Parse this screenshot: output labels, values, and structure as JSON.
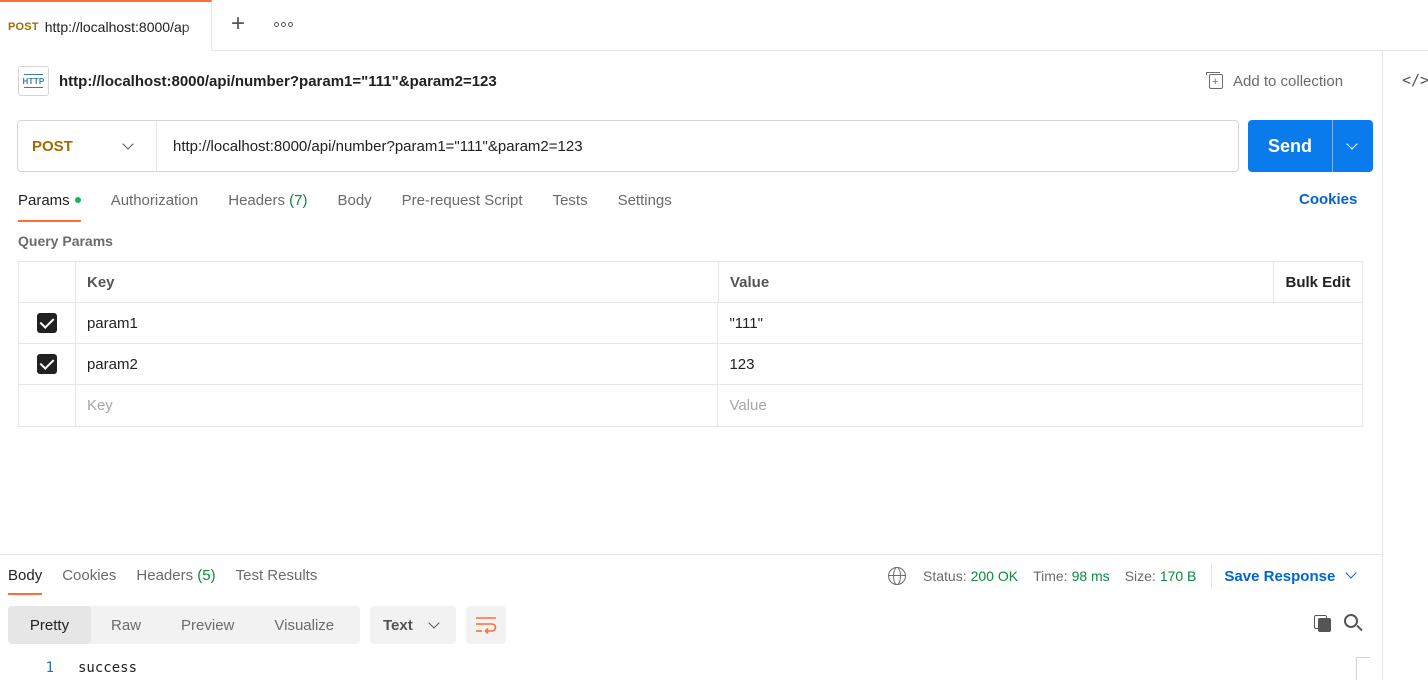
{
  "tab": {
    "method": "POST",
    "title": "http://localhost:8000/ap"
  },
  "tabbar": {
    "new_tab_icon": "plus-icon",
    "more_icon": "ellipsis-icon"
  },
  "request": {
    "title": "http://localhost:8000/api/number?param1=\"111\"&param2=123",
    "add_to_collection": "Add to collection",
    "method": "POST",
    "url": "http://localhost:8000/api/number?param1=\"111\"&param2=123",
    "send_label": "Send"
  },
  "request_tabs": [
    {
      "label": "Params",
      "count": ""
    },
    {
      "label": "Authorization",
      "count": ""
    },
    {
      "label": "Headers",
      "count": "(7)"
    },
    {
      "label": "Body",
      "count": ""
    },
    {
      "label": "Pre-request Script",
      "count": ""
    },
    {
      "label": "Tests",
      "count": ""
    },
    {
      "label": "Settings",
      "count": ""
    }
  ],
  "cookies_link": "Cookies",
  "query_params": {
    "title": "Query Params",
    "headers": {
      "key": "Key",
      "value": "Value",
      "bulk_edit": "Bulk Edit"
    },
    "rows": [
      {
        "checked": true,
        "key": "param1",
        "value": "\"111\""
      },
      {
        "checked": true,
        "key": "param2",
        "value": "123"
      }
    ],
    "placeholder": {
      "key": "Key",
      "value": "Value"
    }
  },
  "response": {
    "tabs": [
      {
        "label": "Body",
        "count": ""
      },
      {
        "label": "Cookies",
        "count": ""
      },
      {
        "label": "Headers",
        "count": "(5)"
      },
      {
        "label": "Test Results",
        "count": ""
      }
    ],
    "status_label": "Status:",
    "status_value": "200 OK",
    "time_label": "Time:",
    "time_value": "98 ms",
    "size_label": "Size:",
    "size_value": "170 B",
    "save_response": "Save Response",
    "formats": [
      "Pretty",
      "Raw",
      "Preview",
      "Visualize"
    ],
    "text_type": "Text",
    "lines": [
      {
        "no": "1",
        "text": "success"
      }
    ]
  },
  "colors": {
    "accent_orange": "#ff6c37",
    "send_blue": "#097bed",
    "link_blue": "#0265d2",
    "method_post": "#a36a00",
    "status_green": "#0a8a3c"
  }
}
